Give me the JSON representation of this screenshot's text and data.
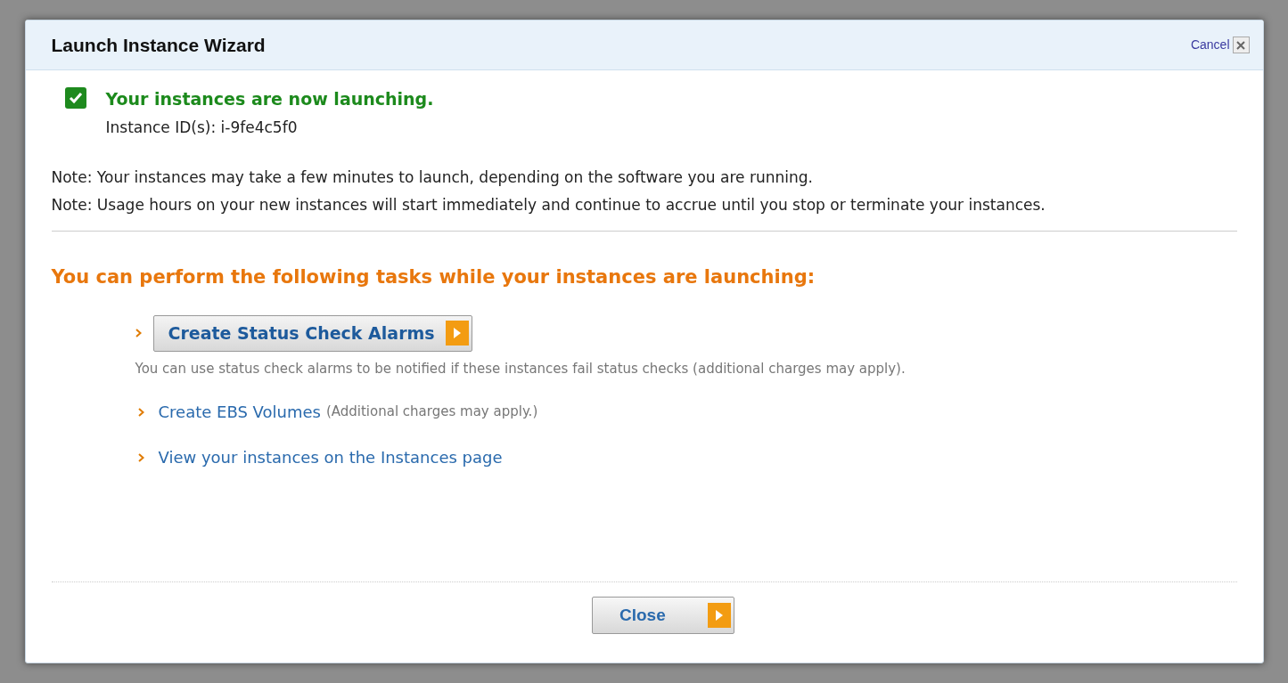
{
  "dialog": {
    "title": "Launch Instance Wizard",
    "cancel": "Cancel"
  },
  "status": {
    "message": "Your instances are now launching.",
    "instance_ids": "Instance ID(s): i-9fe4c5f0"
  },
  "notes": [
    "Note: Your instances may take a few minutes to launch, depending on the software you are running.",
    "Note: Usage hours on your new instances will start immediately and continue to accrue until you stop or terminate your instances."
  ],
  "tasks_heading": "You can perform the following tasks while your instances are launching:",
  "tasks": [
    {
      "kind": "button",
      "label": "Create Status Check Alarms",
      "description": "You can use status check alarms to be notified if these instances fail status checks (additional charges may apply)."
    },
    {
      "kind": "link",
      "label": "Create EBS Volumes",
      "aside": "(Additional charges may apply.)"
    },
    {
      "kind": "link",
      "label": "View your instances on the Instances page"
    }
  ],
  "footer_button": "Close"
}
